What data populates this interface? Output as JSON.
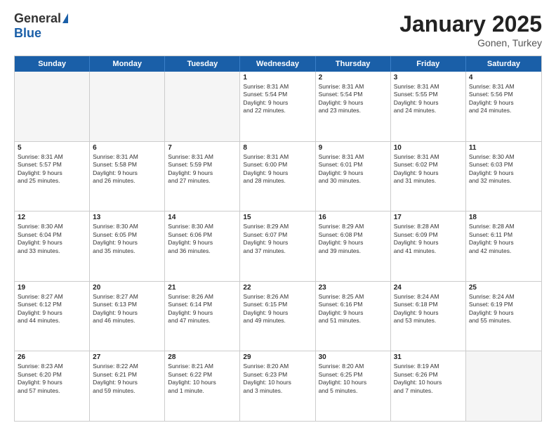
{
  "header": {
    "logo_general": "General",
    "logo_blue": "Blue",
    "month_title": "January 2025",
    "subtitle": "Gonen, Turkey"
  },
  "weekdays": [
    "Sunday",
    "Monday",
    "Tuesday",
    "Wednesday",
    "Thursday",
    "Friday",
    "Saturday"
  ],
  "weeks": [
    [
      {
        "day": "",
        "text": ""
      },
      {
        "day": "",
        "text": ""
      },
      {
        "day": "",
        "text": ""
      },
      {
        "day": "1",
        "text": "Sunrise: 8:31 AM\nSunset: 5:54 PM\nDaylight: 9 hours\nand 22 minutes."
      },
      {
        "day": "2",
        "text": "Sunrise: 8:31 AM\nSunset: 5:54 PM\nDaylight: 9 hours\nand 23 minutes."
      },
      {
        "day": "3",
        "text": "Sunrise: 8:31 AM\nSunset: 5:55 PM\nDaylight: 9 hours\nand 24 minutes."
      },
      {
        "day": "4",
        "text": "Sunrise: 8:31 AM\nSunset: 5:56 PM\nDaylight: 9 hours\nand 24 minutes."
      }
    ],
    [
      {
        "day": "5",
        "text": "Sunrise: 8:31 AM\nSunset: 5:57 PM\nDaylight: 9 hours\nand 25 minutes."
      },
      {
        "day": "6",
        "text": "Sunrise: 8:31 AM\nSunset: 5:58 PM\nDaylight: 9 hours\nand 26 minutes."
      },
      {
        "day": "7",
        "text": "Sunrise: 8:31 AM\nSunset: 5:59 PM\nDaylight: 9 hours\nand 27 minutes."
      },
      {
        "day": "8",
        "text": "Sunrise: 8:31 AM\nSunset: 6:00 PM\nDaylight: 9 hours\nand 28 minutes."
      },
      {
        "day": "9",
        "text": "Sunrise: 8:31 AM\nSunset: 6:01 PM\nDaylight: 9 hours\nand 30 minutes."
      },
      {
        "day": "10",
        "text": "Sunrise: 8:31 AM\nSunset: 6:02 PM\nDaylight: 9 hours\nand 31 minutes."
      },
      {
        "day": "11",
        "text": "Sunrise: 8:30 AM\nSunset: 6:03 PM\nDaylight: 9 hours\nand 32 minutes."
      }
    ],
    [
      {
        "day": "12",
        "text": "Sunrise: 8:30 AM\nSunset: 6:04 PM\nDaylight: 9 hours\nand 33 minutes."
      },
      {
        "day": "13",
        "text": "Sunrise: 8:30 AM\nSunset: 6:05 PM\nDaylight: 9 hours\nand 35 minutes."
      },
      {
        "day": "14",
        "text": "Sunrise: 8:30 AM\nSunset: 6:06 PM\nDaylight: 9 hours\nand 36 minutes."
      },
      {
        "day": "15",
        "text": "Sunrise: 8:29 AM\nSunset: 6:07 PM\nDaylight: 9 hours\nand 37 minutes."
      },
      {
        "day": "16",
        "text": "Sunrise: 8:29 AM\nSunset: 6:08 PM\nDaylight: 9 hours\nand 39 minutes."
      },
      {
        "day": "17",
        "text": "Sunrise: 8:28 AM\nSunset: 6:09 PM\nDaylight: 9 hours\nand 41 minutes."
      },
      {
        "day": "18",
        "text": "Sunrise: 8:28 AM\nSunset: 6:11 PM\nDaylight: 9 hours\nand 42 minutes."
      }
    ],
    [
      {
        "day": "19",
        "text": "Sunrise: 8:27 AM\nSunset: 6:12 PM\nDaylight: 9 hours\nand 44 minutes."
      },
      {
        "day": "20",
        "text": "Sunrise: 8:27 AM\nSunset: 6:13 PM\nDaylight: 9 hours\nand 46 minutes."
      },
      {
        "day": "21",
        "text": "Sunrise: 8:26 AM\nSunset: 6:14 PM\nDaylight: 9 hours\nand 47 minutes."
      },
      {
        "day": "22",
        "text": "Sunrise: 8:26 AM\nSunset: 6:15 PM\nDaylight: 9 hours\nand 49 minutes."
      },
      {
        "day": "23",
        "text": "Sunrise: 8:25 AM\nSunset: 6:16 PM\nDaylight: 9 hours\nand 51 minutes."
      },
      {
        "day": "24",
        "text": "Sunrise: 8:24 AM\nSunset: 6:18 PM\nDaylight: 9 hours\nand 53 minutes."
      },
      {
        "day": "25",
        "text": "Sunrise: 8:24 AM\nSunset: 6:19 PM\nDaylight: 9 hours\nand 55 minutes."
      }
    ],
    [
      {
        "day": "26",
        "text": "Sunrise: 8:23 AM\nSunset: 6:20 PM\nDaylight: 9 hours\nand 57 minutes."
      },
      {
        "day": "27",
        "text": "Sunrise: 8:22 AM\nSunset: 6:21 PM\nDaylight: 9 hours\nand 59 minutes."
      },
      {
        "day": "28",
        "text": "Sunrise: 8:21 AM\nSunset: 6:22 PM\nDaylight: 10 hours\nand 1 minute."
      },
      {
        "day": "29",
        "text": "Sunrise: 8:20 AM\nSunset: 6:23 PM\nDaylight: 10 hours\nand 3 minutes."
      },
      {
        "day": "30",
        "text": "Sunrise: 8:20 AM\nSunset: 6:25 PM\nDaylight: 10 hours\nand 5 minutes."
      },
      {
        "day": "31",
        "text": "Sunrise: 8:19 AM\nSunset: 6:26 PM\nDaylight: 10 hours\nand 7 minutes."
      },
      {
        "day": "",
        "text": ""
      }
    ]
  ]
}
